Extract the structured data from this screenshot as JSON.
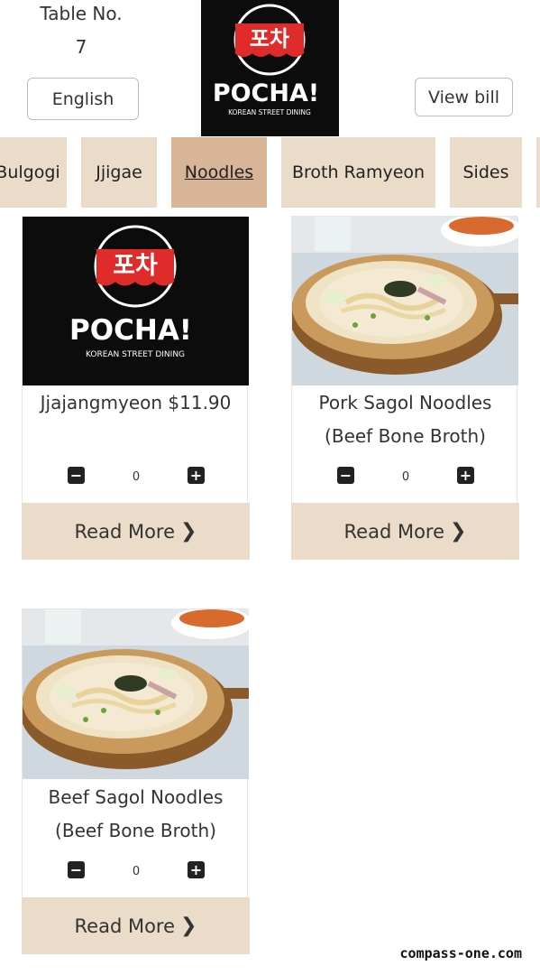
{
  "header": {
    "table_label": "Table No.",
    "table_number": "7",
    "language_button": "English",
    "view_bill_button": "View bill",
    "logo": {
      "korean": "포차",
      "brand": "POCHA!",
      "tagline": "KOREAN STREET DINING"
    }
  },
  "categories": [
    {
      "label": "Bulgogi",
      "active": false
    },
    {
      "label": "Jjigae",
      "active": false
    },
    {
      "label": "Noodles",
      "active": true
    },
    {
      "label": "Broth Ramyeon",
      "active": false
    },
    {
      "label": "Sides",
      "active": false
    }
  ],
  "items": [
    {
      "title": "Jjajangmyeon $11.90",
      "quantity": "0",
      "read_more": "Read More",
      "image": "pocha-logo"
    },
    {
      "title": "Pork Sagol Noodles (Beef Bone Broth)",
      "quantity": "0",
      "read_more": "Read More",
      "image": "noodle-bowl-photo"
    },
    {
      "title": "Beef Sagol Noodles (Beef Bone Broth)",
      "quantity": "0",
      "read_more": "Read More",
      "image": "noodle-bowl-photo"
    }
  ],
  "icons": {
    "minus": "minus-square-icon",
    "plus": "plus-square-icon",
    "chevron": "chevron-right-icon"
  },
  "colors": {
    "tab_bg": "#ebdcc9",
    "tab_active_bg": "#d8b596",
    "logo_red": "#e02b2b",
    "logo_bg": "#0c0c0c"
  },
  "watermark": "compass-one.com"
}
